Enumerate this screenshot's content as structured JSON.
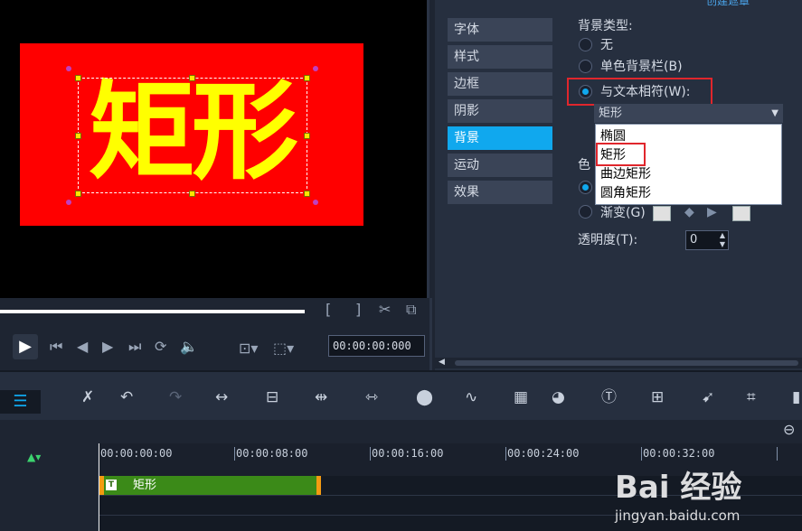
{
  "preview": {
    "title_text": "矩形",
    "title_color": "#ffff00",
    "background_color": "#ff0000",
    "timecode": "00:00:00:000"
  },
  "options": {
    "top_link": "创建遮罩",
    "tabs": [
      "字体",
      "样式",
      "边框",
      "阴影",
      "背景",
      "运动",
      "效果"
    ],
    "active_tab": "背景",
    "background_type_label": "背景类型:",
    "radio_none": "无",
    "radio_single": "单色背景栏(B)",
    "radio_fit_text": "与文本相符(W):",
    "selected_radio": "与文本相符(W):",
    "shape_select_value": "矩形",
    "shape_options": [
      "椭圆",
      "矩形",
      "曲边矩形",
      "圆角矩形"
    ],
    "highlighted_option": "矩形",
    "color_label_partial": "色",
    "radio_gradient": "渐变(G)",
    "opacity_label": "透明度(T):",
    "opacity_value": "0",
    "accent_color": "#10a8ee",
    "highlight_box_color": "#e0262c"
  },
  "timeline": {
    "ruler_labels": [
      "00:00:00:00",
      "00:00:08:00",
      "00:00:16:00",
      "00:00:24:00",
      "00:00:32:00"
    ],
    "clip_label": "矩形",
    "clip_color": "#3b8a18",
    "clip_edge_color": "#f39b12"
  },
  "watermark": {
    "logo": "Bai 经验",
    "site": "jingyan.baidu.com"
  }
}
